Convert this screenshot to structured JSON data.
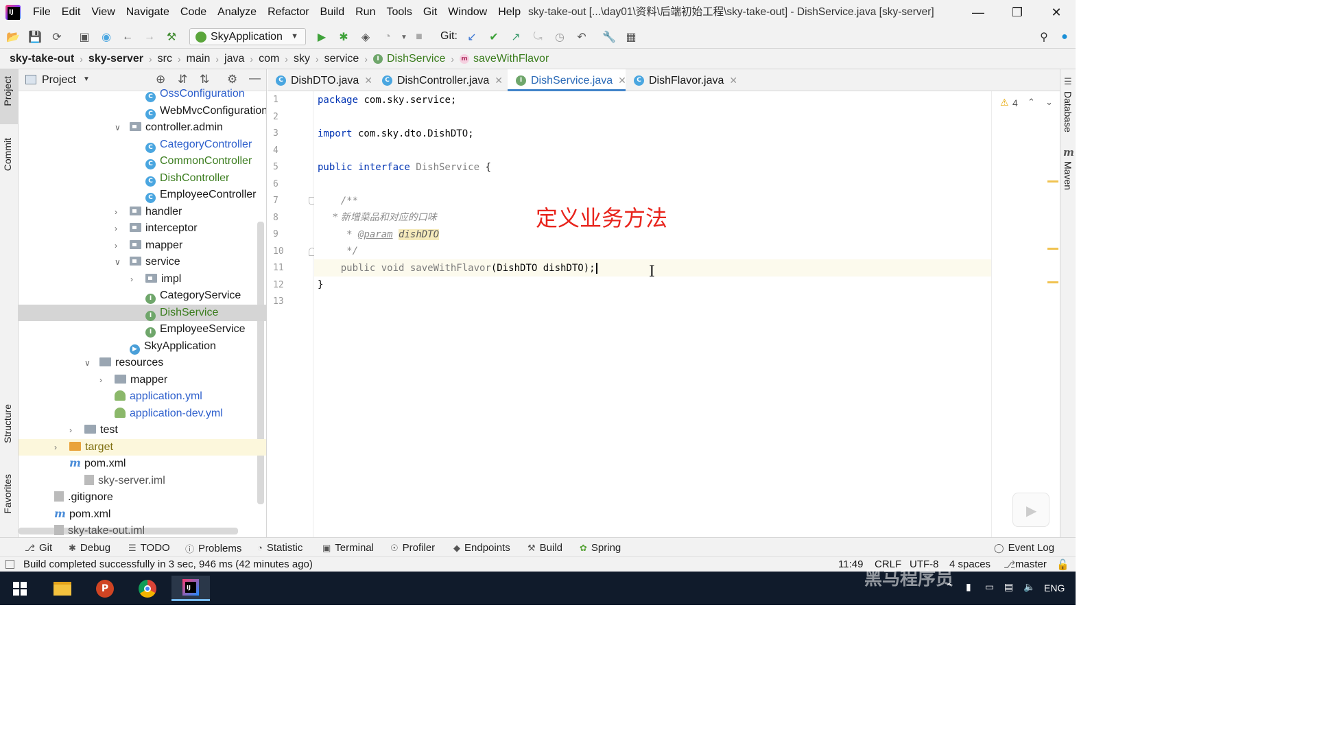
{
  "titlebar": {
    "menu": [
      "File",
      "Edit",
      "View",
      "Navigate",
      "Code",
      "Analyze",
      "Refactor",
      "Build",
      "Run",
      "Tools",
      "Git",
      "Window",
      "Help"
    ],
    "window_title": "sky-take-out [...\\day01\\资料\\后端初始工程\\sky-take-out] - DishService.java [sky-server]"
  },
  "toolbar": {
    "run_config": "SkyApplication",
    "git_label": "Git:"
  },
  "breadcrumb": [
    "sky-take-out",
    "sky-server",
    "src",
    "main",
    "java",
    "com",
    "sky",
    "service",
    "DishService",
    "saveWithFlavor"
  ],
  "left_strip": [
    "Project",
    "Commit",
    "Structure",
    "Favorites"
  ],
  "right_strip": [
    "Database",
    "Maven"
  ],
  "project_panel": {
    "title": "Project",
    "rows": [
      {
        "label": "OssConfiguration",
        "icon": "c",
        "color": "blue"
      },
      {
        "label": "WebMvcConfiguration",
        "icon": "c",
        "color": "default"
      },
      {
        "label": "controller.admin",
        "icon": "pkg",
        "color": "default"
      },
      {
        "label": "CategoryController",
        "icon": "c",
        "color": "blue"
      },
      {
        "label": "CommonController",
        "icon": "c",
        "color": "green"
      },
      {
        "label": "DishController",
        "icon": "c",
        "color": "green"
      },
      {
        "label": "EmployeeController",
        "icon": "c",
        "color": "default"
      },
      {
        "label": "handler",
        "icon": "pkg",
        "color": "default"
      },
      {
        "label": "interceptor",
        "icon": "pkg",
        "color": "default"
      },
      {
        "label": "mapper",
        "icon": "pkg",
        "color": "default"
      },
      {
        "label": "service",
        "icon": "pkg",
        "color": "default"
      },
      {
        "label": "impl",
        "icon": "pkg",
        "color": "default"
      },
      {
        "label": "CategoryService",
        "icon": "i",
        "color": "default"
      },
      {
        "label": "DishService",
        "icon": "i",
        "color": "green"
      },
      {
        "label": "EmployeeService",
        "icon": "i",
        "color": "default"
      },
      {
        "label": "SkyApplication",
        "icon": "app",
        "color": "default"
      },
      {
        "label": "resources",
        "icon": "folder",
        "color": "default"
      },
      {
        "label": "mapper",
        "icon": "folder",
        "color": "default"
      },
      {
        "label": "application.yml",
        "icon": "yml",
        "color": "blue"
      },
      {
        "label": "application-dev.yml",
        "icon": "yml",
        "color": "blue"
      },
      {
        "label": "test",
        "icon": "folder",
        "color": "default"
      },
      {
        "label": "target",
        "icon": "folder-orange",
        "color": "olive"
      },
      {
        "label": "pom.xml",
        "icon": "m",
        "color": "default"
      },
      {
        "label": "sky-server.iml",
        "icon": "iml",
        "color": "gray"
      },
      {
        "label": ".gitignore",
        "icon": "git",
        "color": "default"
      },
      {
        "label": "pom.xml",
        "icon": "m",
        "color": "default"
      },
      {
        "label": "sky-take-out.iml",
        "icon": "iml",
        "color": "gray"
      }
    ]
  },
  "tabs": [
    {
      "label": "DishDTO.java",
      "icon": "c",
      "active": false
    },
    {
      "label": "DishController.java",
      "icon": "c",
      "active": false
    },
    {
      "label": "DishService.java",
      "icon": "i",
      "active": true
    },
    {
      "label": "DishFlavor.java",
      "icon": "c",
      "active": false
    }
  ],
  "editor": {
    "line_numbers": [
      "1",
      "2",
      "3",
      "4",
      "5",
      "6",
      "7",
      "8",
      "9",
      "10",
      "11",
      "12",
      "13"
    ],
    "lines": {
      "l1_kw": "package",
      "l1_rest": " com.sky.service;",
      "l3_kw": "import",
      "l3_rest": " com.sky.dto.DishDTO;",
      "l5_kw": "public interface",
      "l5_name": " DishService",
      "l5_rest": " {",
      "l7": "    /**",
      "l8": "     * 新增菜品和对应的口味",
      "l9_pre": "     * ",
      "l9_tag": "@param",
      "l9_param": "dishDTO",
      "l10": "     */",
      "l11_kw": "    public void",
      "l11_fn": " saveWithFlavor",
      "l11_rest": "(DishDTO dishDTO);",
      "l12": "}"
    },
    "annotation": "定义业务方法",
    "warnings_count": "4"
  },
  "bottom_tools": [
    "Git",
    "Debug",
    "TODO",
    "Problems",
    "Statistic",
    "Terminal",
    "Profiler",
    "Endpoints",
    "Build",
    "Spring"
  ],
  "event_log": "Event Log",
  "status": {
    "message": "Build completed successfully in 3 sec, 946 ms (42 minutes ago)",
    "position": "11:49",
    "line_sep": "CRLF",
    "encoding": "UTF-8",
    "indent": "4 spaces",
    "branch": "master"
  },
  "taskbar": {
    "lang": "ENG",
    "watermark": "黑马程序员"
  }
}
